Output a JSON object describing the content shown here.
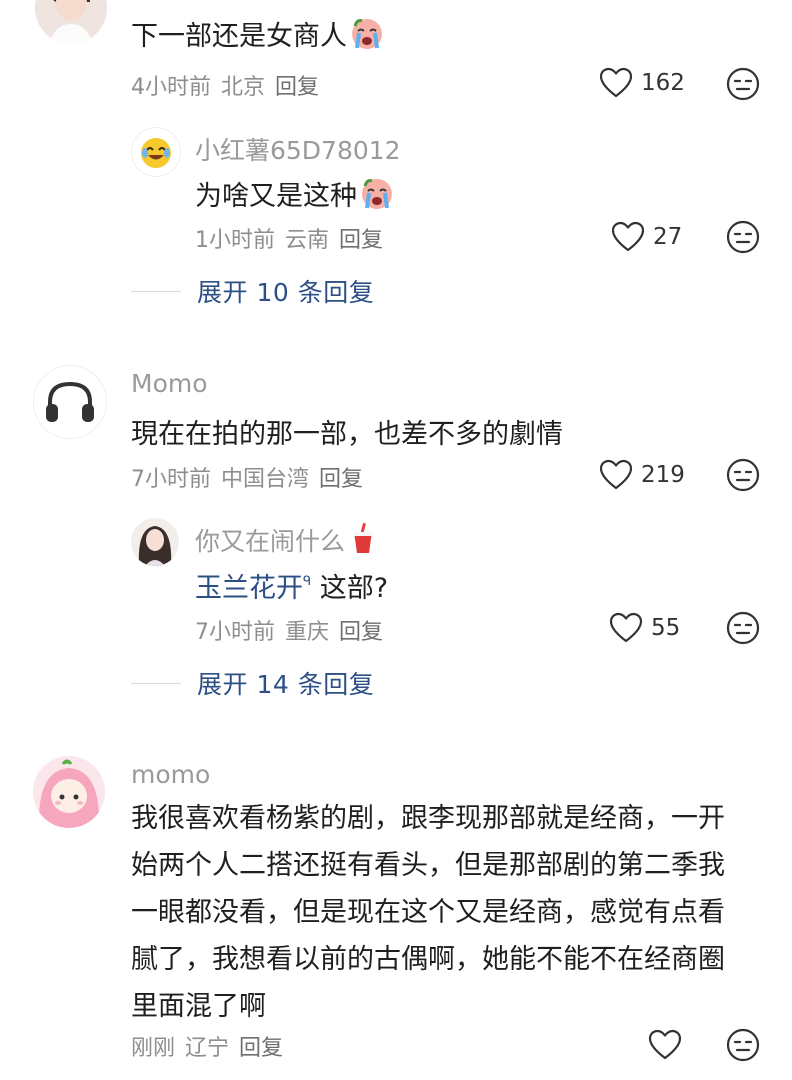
{
  "comments": [
    {
      "username": "",
      "text": "下一部还是女商人",
      "time": "4小时前",
      "location": "北京",
      "reply_label": "回复",
      "likes": "162",
      "reply": {
        "username": "小红薯65D78012",
        "text": "为啥又是这种",
        "time": "1小时前",
        "location": "云南",
        "reply_label": "回复",
        "likes": "27"
      },
      "expand_label": "展开 10 条回复"
    },
    {
      "username": "Momo",
      "text": "現在在拍的那一部，也差不多的劇情",
      "time": "7小时前",
      "location": "中国台湾",
      "reply_label": "回复",
      "likes": "219",
      "reply": {
        "username": "你又在闹什么",
        "mention": "玉兰花开",
        "mention_suffix": "ᑫ",
        "text": " 这部?",
        "time": "7小时前",
        "location": "重庆",
        "reply_label": "回复",
        "likes": "55"
      },
      "expand_label": "展开 14 条回复"
    },
    {
      "username": "momo",
      "text": "我很喜欢看杨紫的剧，跟李现那部就是经商，一开始两个人二搭还挺有看头，但是那部剧的第二季我一眼都没看，但是现在这个又是经商，感觉有点看腻了，我想看以前的古偶啊，她能不能不在经商圈里面混了啊",
      "time": "刚刚",
      "location": "辽宁",
      "reply_label": "回复"
    }
  ],
  "colors": {
    "link": "#2c4f86",
    "muted": "#8e8e8e",
    "text": "#1f1f1f"
  },
  "icons": [
    "heart-icon",
    "neutral-face-icon",
    "crying-emoji",
    "drink-cup-emoji",
    "headphones-avatar",
    "smiley-avatar",
    "girl-avatar"
  ]
}
